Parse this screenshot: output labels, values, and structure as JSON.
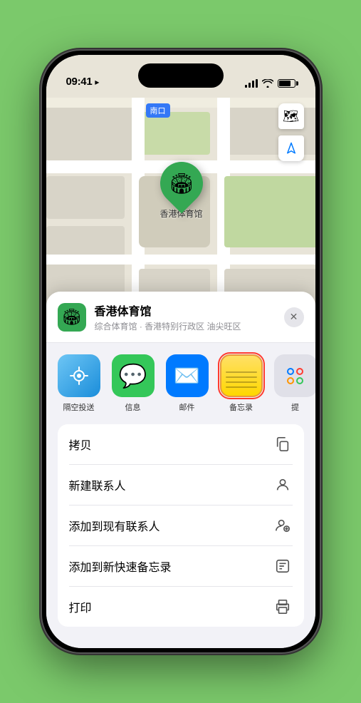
{
  "status": {
    "time": "09:41",
    "arrow": "▲"
  },
  "map": {
    "label": "南口",
    "station_name": "香港体育馆",
    "pin_label": "香港体育馆"
  },
  "controls": {
    "map_icon": "🗺",
    "location_icon": "⊳"
  },
  "place": {
    "name": "香港体育馆",
    "subtitle": "综合体育馆 · 香港特别行政区 油尖旺区",
    "icon": "🏟"
  },
  "share_apps": [
    {
      "key": "airdrop",
      "label": "隔空投送"
    },
    {
      "key": "messages",
      "label": "信息"
    },
    {
      "key": "mail",
      "label": "邮件"
    },
    {
      "key": "notes",
      "label": "备忘录",
      "selected": true
    },
    {
      "key": "more",
      "label": "提"
    }
  ],
  "actions": [
    {
      "label": "拷贝",
      "icon": "📋"
    },
    {
      "label": "新建联系人",
      "icon": "👤"
    },
    {
      "label": "添加到现有联系人",
      "icon": "👤+"
    },
    {
      "label": "添加到新快速备忘录",
      "icon": "📝"
    },
    {
      "label": "打印",
      "icon": "🖨"
    }
  ]
}
